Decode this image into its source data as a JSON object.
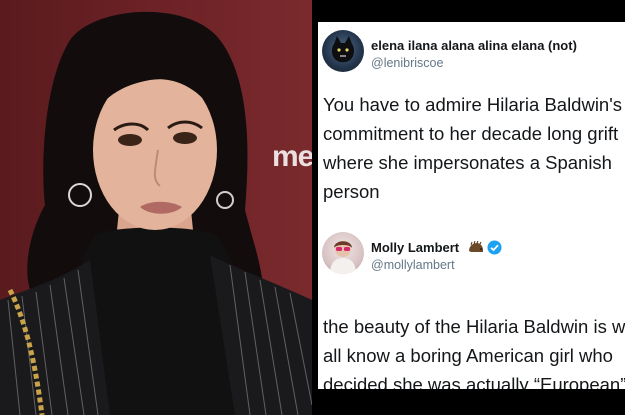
{
  "photo": {
    "backdrop_text": "me",
    "description_icon": "portrait-photo"
  },
  "tweets": [
    {
      "display_name": "elena ilana alana alina elana (not)",
      "handle": "@lenibriscoe",
      "text": "You have to admire Hilaria Baldwin's\ncommitment to her decade long grift\nwhere she impersonates a Spanish\nperson",
      "avatar_icon": "cat-avatar-icon",
      "verified": false
    },
    {
      "display_name": "Molly Lambert",
      "handle": "@mollylambert",
      "text": "the beauty of the Hilaria Baldwin is we\nall know a boring American girl who\ndecided she was actually “European”",
      "avatar_icon": "person-avatar-icon",
      "verified": true,
      "name_emoji_icon": "hedgehog-icon"
    }
  ],
  "colors": {
    "backdrop": "#6b2126",
    "tweet_panel_background": "#000000",
    "card_background": "#ffffff",
    "text": "#14171a",
    "handle": "#657786",
    "verified": "#1da1f2"
  }
}
